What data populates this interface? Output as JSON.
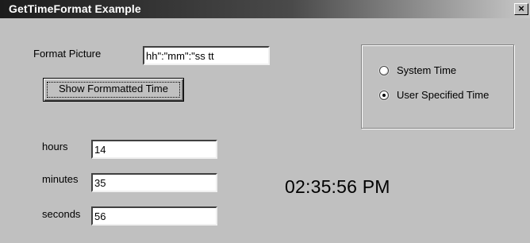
{
  "window": {
    "title": "GetTimeFormat Example",
    "close_glyph": "×"
  },
  "format_picture": {
    "label": "Format Picture",
    "value": "hh\":\"mm\":\"ss tt"
  },
  "show_button": {
    "label": "Show Formmatted Time"
  },
  "time_source": {
    "options": [
      {
        "label": "System Time",
        "selected": false
      },
      {
        "label": "User Specified Time",
        "selected": true
      }
    ]
  },
  "fields": {
    "hours": {
      "label": "hours",
      "value": "14"
    },
    "minutes": {
      "label": "minutes",
      "value": "35"
    },
    "seconds": {
      "label": "seconds",
      "value": "56"
    }
  },
  "result": {
    "formatted_time": "02:35:56 PM"
  }
}
